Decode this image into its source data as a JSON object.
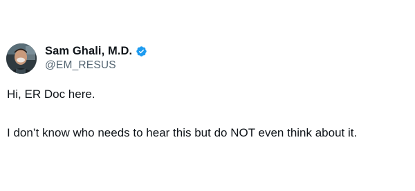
{
  "tweet": {
    "author": {
      "display_name": "Sam Ghali, M.D.",
      "handle": "@EM_RESUS",
      "verified": true,
      "avatar_icon": "profile-photo"
    },
    "text_lines": [
      "Hi, ER Doc here.",
      "I don’t know who needs to hear this but do NOT even think about it."
    ]
  },
  "colors": {
    "primary_text": "#0f1419",
    "secondary_text": "#536471",
    "verified_badge": "#1d9bf0",
    "background": "#ffffff"
  }
}
